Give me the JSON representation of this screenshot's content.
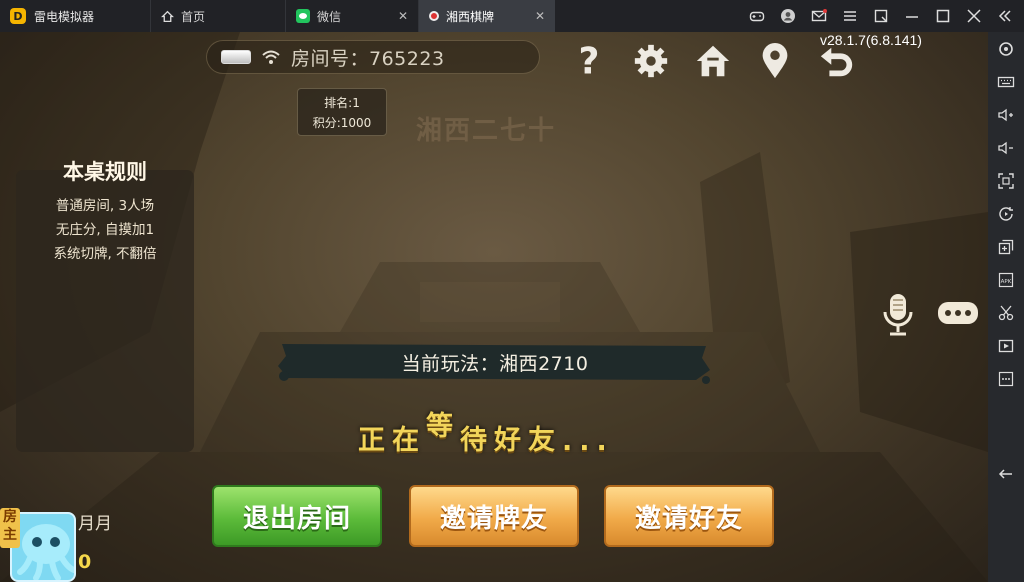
{
  "emulator": {
    "app_name": "雷电模拟器",
    "tabs": [
      {
        "label": "首页",
        "icon": "home-icon"
      },
      {
        "label": "微信",
        "icon": "wechat-icon"
      },
      {
        "label": "湘西棋牌",
        "icon": "game-icon",
        "active": true
      }
    ],
    "window_controls": [
      "gamepad-icon",
      "user-icon",
      "mail-icon",
      "menu-icon",
      "pin-icon",
      "minimize-icon",
      "maximize-icon",
      "close-icon",
      "collapse-sidebar-icon"
    ],
    "sidebar_tools": [
      "settings-icon",
      "keyboard-icon",
      "volume-up-icon",
      "volume-down-icon",
      "fullscreen-icon",
      "rotate-icon",
      "multi-instance-icon",
      "apk-install-icon",
      "scissors-icon",
      "video-record-icon",
      "more-icon",
      "back-icon"
    ]
  },
  "game": {
    "room_label": "房间号：765223",
    "version": "v28.1.7(6.8.141)",
    "rank": "排名:1",
    "points": "积分:1000",
    "title": "湘西二七十",
    "rules": {
      "title": "本桌规则",
      "lines": [
        "普通房间, 3人场",
        "无庄分, 自摸加1",
        "系统切牌, 不翻倍"
      ]
    },
    "mode": "当前玩法：湘西2710",
    "waiting_chars": [
      "正",
      "在",
      "等",
      "待",
      "好",
      "友",
      ".",
      ".",
      "."
    ],
    "buttons": {
      "exit": "退出房间",
      "invite_card_friends": "邀请牌友",
      "invite_friends": "邀请好友"
    },
    "top_icons": [
      "help-icon",
      "settings-icon",
      "home-icon",
      "location-icon",
      "return-icon"
    ],
    "player": {
      "host_badge": "房主",
      "name": "月月",
      "score": "0"
    }
  }
}
